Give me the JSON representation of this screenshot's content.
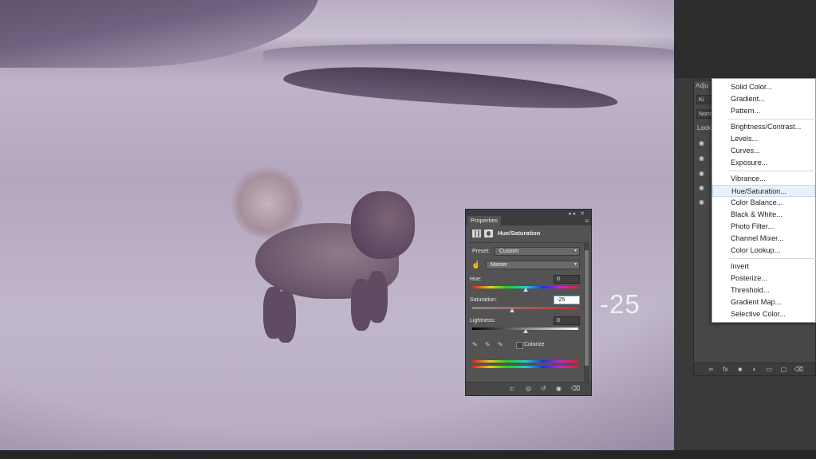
{
  "overlay": {
    "big_value": "-25"
  },
  "properties_panel": {
    "tab_label": "Properties",
    "adjustment_title": "Hue/Saturation",
    "preset_label": "Preset:",
    "preset_value": "Custom",
    "range_value": "Master",
    "hue": {
      "label": "Hue:",
      "value": "0",
      "slider_fraction": 0.5
    },
    "saturation": {
      "label": "Saturation:",
      "value": "-25",
      "slider_fraction": 0.375
    },
    "lightness": {
      "label": "Lightness:",
      "value": "0",
      "slider_fraction": 0.5
    },
    "colorize_label": "Colorize",
    "colorize_checked": false
  },
  "layers_panel": {
    "tab_label": "Adju",
    "kind_field": "Ki",
    "blend_mode": "Norm",
    "lock_label": "Lock:"
  },
  "adjustment_menu": {
    "items": [
      "Solid Color...",
      "Gradient...",
      "Pattern...",
      "Brightness/Contrast...",
      "Levels...",
      "Curves...",
      "Exposure...",
      "Vibrance...",
      "Hue/Saturation...",
      "Color Balance...",
      "Black & White...",
      "Photo Filter...",
      "Channel Mixer...",
      "Color Lookup...",
      "Invert",
      "Posterize...",
      "Threshold...",
      "Gradient Map...",
      "Selective Color..."
    ],
    "highlighted": "Hue/Saturation..."
  },
  "icons": {
    "visibility": "eye-icon",
    "targeted_adjustment": "hand-icon",
    "eyedropper": "eyedropper-icon",
    "clip": "clip-to-layer-icon",
    "reset": "reset-icon",
    "delete": "trash-icon"
  },
  "colors": {
    "menu_highlight": "#e8f1fb",
    "panel": "#535353"
  }
}
